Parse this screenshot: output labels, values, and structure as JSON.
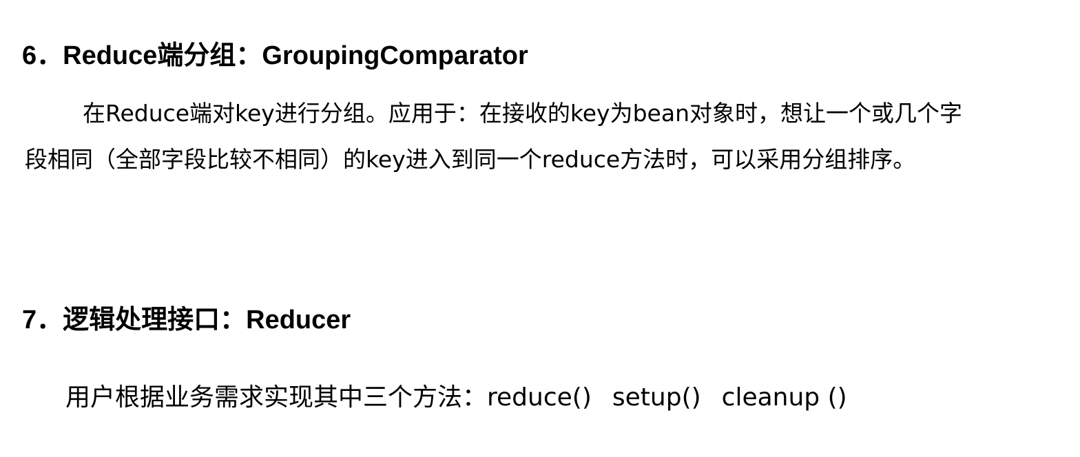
{
  "section6": {
    "heading": "6．Reduce端分组：GroupingComparator",
    "line1": "在Reduce端对key进行分组。应用于：在接收的key为bean对象时，想让一个或几个字",
    "line2": "段相同（全部字段比较不相同）的key进入到同一个reduce方法时，可以采用分组排序。"
  },
  "section7": {
    "heading": "7．逻辑处理接口：Reducer",
    "intro": "用户根据业务需求实现其中三个方法：",
    "methods": [
      "reduce()",
      "setup()",
      "cleanup ()"
    ]
  }
}
